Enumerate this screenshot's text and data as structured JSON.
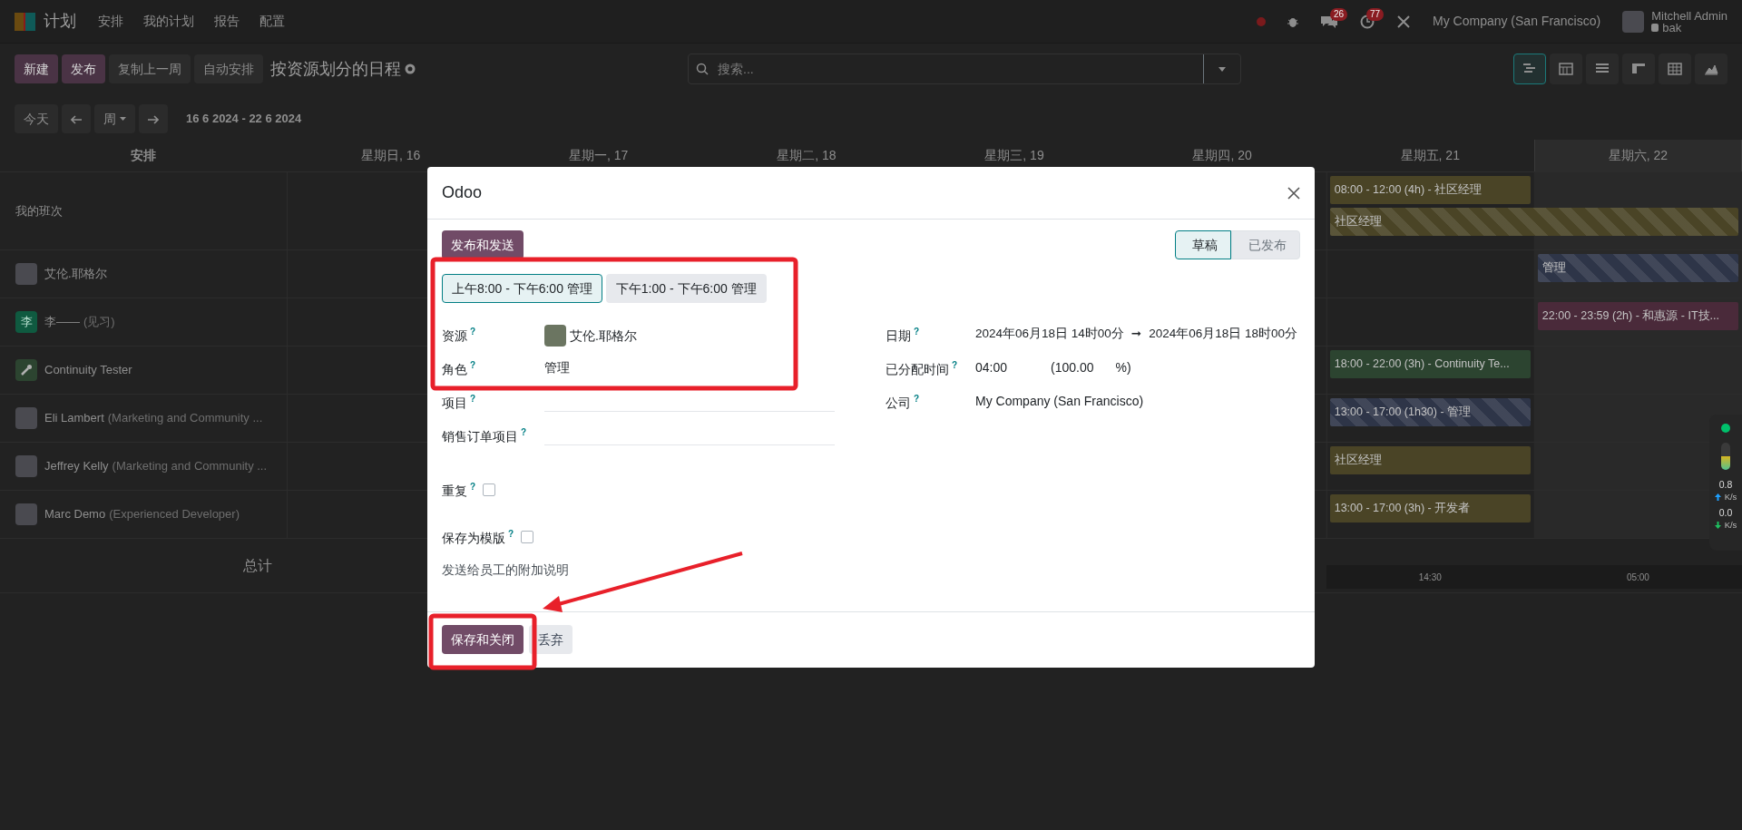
{
  "navbar": {
    "app_name": "计划",
    "menus": [
      "安排",
      "我的计划",
      "报告",
      "配置"
    ],
    "systray": {
      "messages_count": "26",
      "activities_count": "77",
      "company": "My Company (San Francisco)",
      "user_name": "Mitchell Admin",
      "database": "bak"
    }
  },
  "control_panel": {
    "buttons": [
      {
        "label": "新建",
        "kind": "primary"
      },
      {
        "label": "发布",
        "kind": "primary"
      },
      {
        "label": "复制上一周",
        "kind": "secondary"
      },
      {
        "label": "自动安排",
        "kind": "secondary"
      }
    ],
    "title": "按资源划分的日程",
    "search": {
      "placeholder": "搜索..."
    },
    "views": [
      {
        "kind": "gantt",
        "selected": true
      },
      {
        "kind": "calendar",
        "selected": false
      },
      {
        "kind": "list",
        "selected": false
      },
      {
        "kind": "kanban",
        "selected": false
      },
      {
        "kind": "pivot",
        "selected": false
      },
      {
        "kind": "graph",
        "selected": false
      }
    ]
  },
  "date_nav": {
    "today": "今天",
    "scale": "周",
    "range": "16 6 2024 - 22 6 2024"
  },
  "gantt": {
    "group_header": "安排",
    "days": [
      {
        "label": "星期日, 16",
        "today": false
      },
      {
        "label": "星期一, 17",
        "today": false
      },
      {
        "label": "星期二, 18",
        "today": false
      },
      {
        "label": "星期三, 19",
        "today": false
      },
      {
        "label": "星期四, 20",
        "today": false
      },
      {
        "label": "星期五, 21",
        "today": false
      },
      {
        "label": "星期六, 22",
        "today": true
      }
    ],
    "rows": [
      {
        "kind": "group",
        "name": "我的班次",
        "pills": [
          {
            "kind": "fri",
            "text": "08:00 - 12:00 (4h) - 社区经理",
            "color": "#4a4426",
            "striped": false
          },
          {
            "kind": "fri-sat",
            "text": "社区经理",
            "color": "#4a4426",
            "striped": true
          }
        ]
      },
      {
        "kind": "photo",
        "name": "艾伦.耶格尔",
        "pills": [
          {
            "kind": "sat",
            "text": "管理",
            "color": "#2e3548",
            "striped": true
          }
        ]
      },
      {
        "kind": "letter",
        "initial": "李",
        "name": "李——",
        "role": "(见习)",
        "pills": [
          {
            "kind": "sat",
            "text": "22:00 - 23:59 (2h) - 和惠源 - IT技...",
            "color": "#4a2a3a",
            "striped": false
          }
        ]
      },
      {
        "kind": "wrench",
        "name": "Continuity Tester",
        "pills": [
          {
            "kind": "fri",
            "text": "18:00 - 22:00 (3h) - Continuity Te...",
            "color": "#2c4430",
            "striped": false
          }
        ]
      },
      {
        "kind": "photo",
        "name": "Eli Lambert",
        "role": "(Marketing and Community ...",
        "pills": [
          {
            "kind": "fri",
            "text": "13:00 - 17:00 (1h30) - 管理",
            "color": "#2e3548",
            "striped": true
          }
        ]
      },
      {
        "kind": "photo",
        "name": "Jeffrey Kelly",
        "role": "(Marketing and Community ...",
        "pills": [
          {
            "kind": "fri",
            "text": "社区经理",
            "color": "#4a4426",
            "striped": false
          }
        ]
      },
      {
        "kind": "photo",
        "name": "Marc Demo",
        "role": "(Experienced Developer)",
        "pills": [
          {
            "kind": "fri",
            "text": "13:00 - 17:00 (3h) - 开发者",
            "color": "#4a4426",
            "striped": false
          }
        ]
      }
    ],
    "total_label": "总计",
    "totals": [
      {
        "kind": "fri",
        "text": "14:30"
      },
      {
        "kind": "sat",
        "text": "05:00"
      }
    ]
  },
  "dialog": {
    "title": "Odoo",
    "publish_button": "发布和发送",
    "stages": [
      {
        "label": "草稿",
        "selected": true
      },
      {
        "label": "已发布",
        "selected": false
      }
    ],
    "templates": [
      {
        "label": "上午8:00 - 下午6:00 管理",
        "selected": true
      },
      {
        "label": "下午1:00 - 下午6:00 管理",
        "selected": false
      }
    ],
    "left_fields": [
      {
        "kind": "avatar",
        "label": "资源",
        "help": "?",
        "value": "艾伦.耶格尔"
      },
      {
        "kind": "text",
        "label": "角色",
        "help": "?",
        "value": "管理"
      },
      {
        "kind": "text",
        "label": "项目",
        "help": "?"
      },
      {
        "kind": "text",
        "label": "销售订单项目",
        "help": "?"
      },
      {
        "kind": "checkbox",
        "label": "重复",
        "help": "?",
        "checked": false
      },
      {
        "kind": "checkbox",
        "label": "保存为模版",
        "help": "?",
        "checked": false
      }
    ],
    "right_fields": [
      {
        "kind": "daterange",
        "label": "日期",
        "help": "?",
        "start": "2024年06月18日 14时00分",
        "arrow": "➞",
        "end": "2024年06月18日 18时00分"
      },
      {
        "kind": "duration",
        "label": "已分配时间",
        "help": "?",
        "value": "04:00",
        "percent": "(100.00",
        "unit": "%)"
      },
      {
        "kind": "text",
        "label": "公司",
        "help": "?",
        "value": "My Company (San Francisco)"
      }
    ],
    "note_placeholder": "发送给员工的附加说明",
    "buttons": [
      {
        "label": "保存和关闭",
        "kind": "primary"
      },
      {
        "label": "丢弃",
        "kind": "secondary"
      }
    ]
  },
  "network_widget": {
    "level": 0.5,
    "upload": "0.8",
    "upload_unit": "K/s",
    "download": "0.0",
    "download_unit": "K/s"
  }
}
